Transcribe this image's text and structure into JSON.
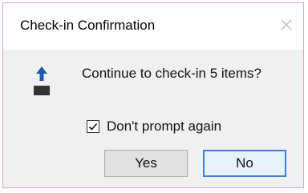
{
  "dialog": {
    "title": "Check-in Confirmation",
    "message": "Continue to check-in 5 items?",
    "checkbox": {
      "label": "Don't prompt again",
      "checked": true
    },
    "buttons": {
      "yes_label": "Yes",
      "no_label": "No"
    },
    "icons": {
      "close": "close-icon",
      "upload": "upload-arrow-icon",
      "check": "checkmark-icon"
    },
    "colors": {
      "border": "#d9a3d4",
      "arrow": "#1e5aa8",
      "default_button_border": "#3c7fd1"
    }
  }
}
